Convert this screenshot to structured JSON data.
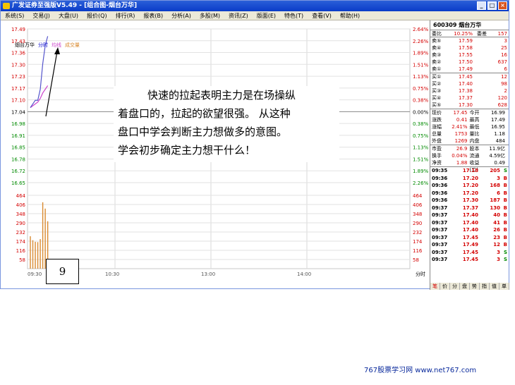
{
  "window": {
    "title": "广发证券至强版V5.49 - [组合图-烟台万华]",
    "buttons": [
      "_",
      "□",
      "×"
    ]
  },
  "menu": [
    "系统(S)",
    "交易(J)",
    "大盘(U)",
    "报价(Q)",
    "排行(R)",
    "报表(B)",
    "分析(A)",
    "多股(M)",
    "资讯(Z)",
    "版面(E)",
    "特色(T)",
    "查看(V)",
    "帮助(H)"
  ],
  "legend": {
    "name": "烟台万华",
    "mode": "分时",
    "avg": "均线",
    "vol": "成交量"
  },
  "colors": {
    "price_line": "#5555cc",
    "avg_line": "#cc44cc",
    "up": "#d40000",
    "down": "#008a00",
    "vol_bar": "#d98a30"
  },
  "chart_data": {
    "type": "line",
    "price_ticks_up": [
      "17.49",
      "17.43",
      "17.36",
      "17.30",
      "17.23",
      "17.17",
      "17.10"
    ],
    "price_base": "17.04",
    "price_ticks_down": [
      "16.98",
      "16.91",
      "16.85",
      "16.78",
      "16.72",
      "16.65"
    ],
    "pct_ticks_up": [
      "2.64%",
      "2.26%",
      "1.89%",
      "1.51%",
      "1.13%",
      "0.75%",
      "0.38%"
    ],
    "pct_base": "0.00%",
    "pct_ticks_down": [
      "0.38%",
      "0.75%",
      "1.13%",
      "1.51%",
      "1.89%",
      "2.26%"
    ],
    "vol_ticks": [
      "464",
      "406",
      "348",
      "290",
      "232",
      "174",
      "116",
      "58"
    ],
    "x_ticks": [
      "09:30",
      "10:30",
      "13:00",
      "14:00"
    ],
    "price_ylim": [
      16.65,
      17.49
    ],
    "price_series": [
      {
        "minute": 0,
        "price": 17.06
      },
      {
        "minute": 1,
        "price": 17.08
      },
      {
        "minute": 2,
        "price": 17.1
      },
      {
        "minute": 3,
        "price": 17.1
      },
      {
        "minute": 4,
        "price": 17.16
      },
      {
        "minute": 5,
        "price": 17.3
      },
      {
        "minute": 6,
        "price": 17.4
      },
      {
        "minute": 7,
        "price": 17.45
      }
    ],
    "avg_series": [
      {
        "minute": 0,
        "price": 17.06
      },
      {
        "minute": 1,
        "price": 17.07
      },
      {
        "minute": 2,
        "price": 17.08
      },
      {
        "minute": 3,
        "price": 17.09
      },
      {
        "minute": 4,
        "price": 17.11
      },
      {
        "minute": 5,
        "price": 17.14
      },
      {
        "minute": 6,
        "price": 17.16
      },
      {
        "minute": 7,
        "price": 17.18
      }
    ],
    "volume": [
      205,
      180,
      170,
      168,
      187,
      420,
      380,
      300
    ],
    "vol_ylim": [
      0,
      464
    ]
  },
  "annotation": {
    "lines": [
      "快速的拉起表明主力是在场操纵",
      "着盘口的，拉起的欲望很强。 从这种",
      "盘口中学会判断主力想做多的意图。",
      "学会初步确定主力想干什么！"
    ]
  },
  "label_box": "9",
  "side": {
    "code": "600309",
    "name": "烟台万华",
    "ratio": {
      "k1": "委比",
      "v1": "10.25%",
      "k2": "委差",
      "v2": "157"
    },
    "sells": [
      {
        "k": "卖⑤",
        "p": "17.59",
        "v": "3"
      },
      {
        "k": "卖④",
        "p": "17.58",
        "v": "25"
      },
      {
        "k": "卖③",
        "p": "17.55",
        "v": "16"
      },
      {
        "k": "卖②",
        "p": "17.50",
        "v": "637"
      },
      {
        "k": "卖①",
        "p": "17.49",
        "v": "6"
      }
    ],
    "buys": [
      {
        "k": "买①",
        "p": "17.45",
        "v": "12"
      },
      {
        "k": "买②",
        "p": "17.40",
        "v": "98"
      },
      {
        "k": "买③",
        "p": "17.38",
        "v": "2"
      },
      {
        "k": "买④",
        "p": "17.37",
        "v": "120"
      },
      {
        "k": "买⑤",
        "p": "17.30",
        "v": "628"
      }
    ],
    "quote": [
      {
        "k1": "现价",
        "v1": "17.45",
        "k2": "今开",
        "v2": "16.99"
      },
      {
        "k1": "涨跌",
        "v1": "0.41",
        "k2": "最高",
        "v2": "17.49"
      },
      {
        "k1": "涨幅",
        "v1": "2.41%",
        "k2": "最低",
        "v2": "16.95"
      },
      {
        "k1": "总量",
        "v1": "1753",
        "k2": "量比",
        "v2": "1.18"
      },
      {
        "k1": "外盘",
        "v1": "1269",
        "k2": "内盘",
        "v2": "484"
      }
    ],
    "fund": [
      {
        "k1": "市盈",
        "v1": "26.9",
        "k2": "股本",
        "v2": "11.9亿"
      },
      {
        "k1": "换手",
        "v1": "0.04%",
        "k2": "流通",
        "v2": "4.59亿"
      },
      {
        "k1": "净资",
        "v1": "1.88",
        "k2": "收益(二)",
        "v2": "0.49"
      }
    ],
    "ticks": [
      {
        "t": "09:35",
        "p": "17.18",
        "v": "205",
        "bs": "S"
      },
      {
        "t": "09:36",
        "p": "17.20",
        "v": "3",
        "bs": "B"
      },
      {
        "t": "09:36",
        "p": "17.20",
        "v": "168",
        "bs": "B"
      },
      {
        "t": "09:36",
        "p": "17.20",
        "v": "6",
        "bs": "B"
      },
      {
        "t": "09:36",
        "p": "17.30",
        "v": "187",
        "bs": "B"
      },
      {
        "t": "09:37",
        "p": "17.37",
        "v": "130",
        "bs": "B"
      },
      {
        "t": "09:37",
        "p": "17.40",
        "v": "40",
        "bs": "B"
      },
      {
        "t": "09:37",
        "p": "17.40",
        "v": "41",
        "bs": "B"
      },
      {
        "t": "09:37",
        "p": "17.40",
        "v": "26",
        "bs": "B"
      },
      {
        "t": "09:37",
        "p": "17.45",
        "v": "23",
        "bs": "B"
      },
      {
        "t": "09:37",
        "p": "17.49",
        "v": "12",
        "bs": "B"
      },
      {
        "t": "09:37",
        "p": "17.45",
        "v": "3",
        "bs": "S"
      },
      {
        "t": "09:37",
        "p": "17.45",
        "v": "3",
        "bs": "S"
      }
    ],
    "tabs": [
      "笔",
      "价",
      "分",
      "盘",
      "势",
      "指",
      "值",
      "单"
    ],
    "bottom_left": "分时"
  },
  "footer": "767股票学习网 www.net767.com"
}
